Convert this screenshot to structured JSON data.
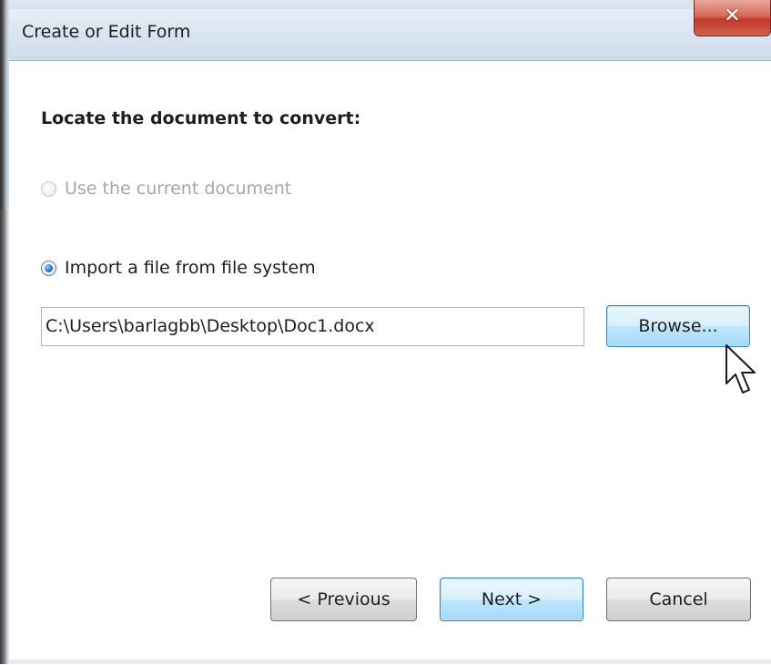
{
  "window": {
    "title": "Create or Edit Form",
    "close_icon": "close-icon"
  },
  "content": {
    "heading": "Locate the document to convert:",
    "options": [
      {
        "label": "Use the current document",
        "selected": false,
        "enabled": false
      },
      {
        "label": "Import a file from file system",
        "selected": true,
        "enabled": true
      }
    ],
    "file_path": "C:\\Users\\barlagbb\\Desktop\\Doc1.docx",
    "browse_label": "Browse..."
  },
  "buttons": {
    "previous_label": "< Previous",
    "next_label": "Next >",
    "cancel_label": "Cancel"
  },
  "colors": {
    "accent": "#2f7fd1",
    "close_button": "#c0392b",
    "title_bar": "#d9e4f0"
  }
}
